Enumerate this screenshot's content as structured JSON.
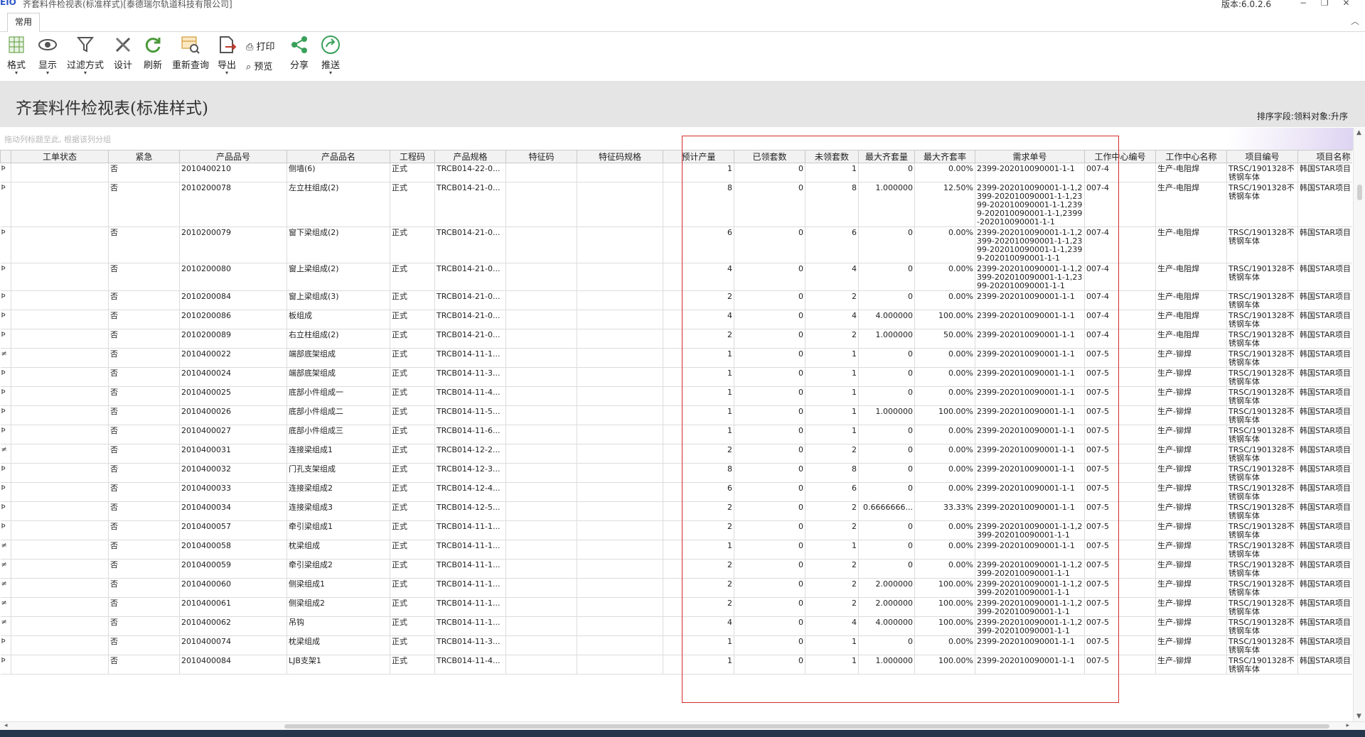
{
  "window": {
    "logo": "EIO",
    "title": "齐套料件检视表(标准样式)[泰德瑞尔轨道科技有限公司]",
    "version": "版本:6.0.2.6",
    "controls": "−  ❐  ✕"
  },
  "tabs": [
    {
      "label": "常用"
    }
  ],
  "collapse_glyph": "︿",
  "toolbar": {
    "format": "格式",
    "display": "显示",
    "filter": "过滤方式",
    "design": "设计",
    "refresh": "刷新",
    "requery": "重新查询",
    "export": "导出",
    "print": "打印",
    "preview": "预览",
    "share": "分享",
    "push": "推送",
    "dropdown_glyph": "▾"
  },
  "page": {
    "title": "齐套料件检视表(标准样式)",
    "sort_info": "排序字段:领料对象:升序"
  },
  "group_hint": "拖动列标题至此, 根据该列分组",
  "columns": [
    "工单状态",
    "紧急",
    "产品品号",
    "产品品名",
    "工程码",
    "产品规格",
    "特征码",
    "特征码规格",
    "预计产量",
    "已领套数",
    "未领套数",
    "最大齐套量",
    "最大齐套率",
    "需求单号",
    "工作中心编号",
    "工作中心名称",
    "项目编号",
    "项目名称"
  ],
  "rows": [
    {
      "ind": "Þ",
      "urgent": "否",
      "code": "2010400210",
      "name": "侧墙(6)",
      "eng": "正式",
      "spec": "TRCB014-22-0...",
      "feat": "",
      "featspec": "",
      "plan": "1",
      "taken": "0",
      "untaken": "1",
      "maxqty": "0",
      "maxrate": "0.00%",
      "req": "2399-202010090001-1-1",
      "wc": "007-4",
      "wcname": "生产-电阻焊",
      "proj": "TRSC/1901328不锈钢车体",
      "projname": "韩国STAR项目"
    },
    {
      "ind": "Þ",
      "urgent": "否",
      "code": "2010200078",
      "name": "左立柱组成(2)",
      "eng": "正式",
      "spec": "TRCB014-21-0...",
      "feat": "",
      "featspec": "",
      "plan": "8",
      "taken": "0",
      "untaken": "8",
      "maxqty": "1.000000",
      "maxrate": "12.50%",
      "req": "2399-202010090001-1-1,2399-202010090001-1-1,2399-202010090001-1-1,2399-202010090001-1-1,2399-202010090001-1-1",
      "wc": "007-4",
      "wcname": "生产-电阻焊",
      "proj": "TRSC/1901328不锈钢车体",
      "projname": "韩国STAR项目"
    },
    {
      "ind": "Þ",
      "urgent": "否",
      "code": "2010200079",
      "name": "窗下梁组成(2)",
      "eng": "正式",
      "spec": "TRCB014-21-0...",
      "feat": "",
      "featspec": "",
      "plan": "6",
      "taken": "0",
      "untaken": "6",
      "maxqty": "0",
      "maxrate": "0.00%",
      "req": "2399-202010090001-1-1,2399-202010090001-1-1,2399-202010090001-1-1,2399-202010090001-1-1",
      "wc": "007-4",
      "wcname": "生产-电阻焊",
      "proj": "TRSC/1901328不锈钢车体",
      "projname": "韩国STAR项目"
    },
    {
      "ind": "Þ",
      "urgent": "否",
      "code": "2010200080",
      "name": "窗上梁组成(2)",
      "eng": "正式",
      "spec": "TRCB014-21-0...",
      "feat": "",
      "featspec": "",
      "plan": "4",
      "taken": "0",
      "untaken": "4",
      "maxqty": "0",
      "maxrate": "0.00%",
      "req": "2399-202010090001-1-1,2399-202010090001-1-1,2399-202010090001-1-1",
      "wc": "007-4",
      "wcname": "生产-电阻焊",
      "proj": "TRSC/1901328不锈钢车体",
      "projname": "韩国STAR项目"
    },
    {
      "ind": "Þ",
      "urgent": "否",
      "code": "2010200084",
      "name": "窗上梁组成(3)",
      "eng": "正式",
      "spec": "TRCB014-21-0...",
      "feat": "",
      "featspec": "",
      "plan": "2",
      "taken": "0",
      "untaken": "2",
      "maxqty": "0",
      "maxrate": "0.00%",
      "req": "2399-202010090001-1-1",
      "wc": "007-4",
      "wcname": "生产-电阻焊",
      "proj": "TRSC/1901328不锈钢车体",
      "projname": "韩国STAR项目"
    },
    {
      "ind": "Þ",
      "urgent": "否",
      "code": "2010200086",
      "name": "板组成",
      "eng": "正式",
      "spec": "TRCB014-21-0...",
      "feat": "",
      "featspec": "",
      "plan": "4",
      "taken": "0",
      "untaken": "4",
      "maxqty": "4.000000",
      "maxrate": "100.00%",
      "req": "2399-202010090001-1-1",
      "wc": "007-4",
      "wcname": "生产-电阻焊",
      "proj": "TRSC/1901328不锈钢车体",
      "projname": "韩国STAR项目"
    },
    {
      "ind": "Þ",
      "urgent": "否",
      "code": "2010200089",
      "name": "右立柱组成(2)",
      "eng": "正式",
      "spec": "TRCB014-21-0...",
      "feat": "",
      "featspec": "",
      "plan": "2",
      "taken": "0",
      "untaken": "2",
      "maxqty": "1.000000",
      "maxrate": "50.00%",
      "req": "2399-202010090001-1-1",
      "wc": "007-4",
      "wcname": "生产-电阻焊",
      "proj": "TRSC/1901328不锈钢车体",
      "projname": "韩国STAR项目"
    },
    {
      "ind": "≠",
      "urgent": "否",
      "code": "2010400022",
      "name": "端部底架组成",
      "eng": "正式",
      "spec": "TRCB014-11-1...",
      "feat": "",
      "featspec": "",
      "plan": "1",
      "taken": "0",
      "untaken": "1",
      "maxqty": "0",
      "maxrate": "0.00%",
      "req": "2399-202010090001-1-1",
      "wc": "007-5",
      "wcname": "生产-铆焊",
      "proj": "TRSC/1901328不锈钢车体",
      "projname": "韩国STAR项目"
    },
    {
      "ind": "Þ",
      "urgent": "否",
      "code": "2010400024",
      "name": "端部底架组成",
      "eng": "正式",
      "spec": "TRCB014-11-3...",
      "feat": "",
      "featspec": "",
      "plan": "1",
      "taken": "0",
      "untaken": "1",
      "maxqty": "0",
      "maxrate": "0.00%",
      "req": "2399-202010090001-1-1",
      "wc": "007-5",
      "wcname": "生产-铆焊",
      "proj": "TRSC/1901328不锈钢车体",
      "projname": "韩国STAR项目"
    },
    {
      "ind": "Þ",
      "urgent": "否",
      "code": "2010400025",
      "name": "底部小件组成一",
      "eng": "正式",
      "spec": "TRCB014-11-4...",
      "feat": "",
      "featspec": "",
      "plan": "1",
      "taken": "0",
      "untaken": "1",
      "maxqty": "0",
      "maxrate": "0.00%",
      "req": "2399-202010090001-1-1",
      "wc": "007-5",
      "wcname": "生产-铆焊",
      "proj": "TRSC/1901328不锈钢车体",
      "projname": "韩国STAR项目"
    },
    {
      "ind": "Þ",
      "urgent": "否",
      "code": "2010400026",
      "name": "底部小件组成二",
      "eng": "正式",
      "spec": "TRCB014-11-5...",
      "feat": "",
      "featspec": "",
      "plan": "1",
      "taken": "0",
      "untaken": "1",
      "maxqty": "1.000000",
      "maxrate": "100.00%",
      "req": "2399-202010090001-1-1",
      "wc": "007-5",
      "wcname": "生产-铆焊",
      "proj": "TRSC/1901328不锈钢车体",
      "projname": "韩国STAR项目"
    },
    {
      "ind": "Þ",
      "urgent": "否",
      "code": "2010400027",
      "name": "底部小件组成三",
      "eng": "正式",
      "spec": "TRCB014-11-6...",
      "feat": "",
      "featspec": "",
      "plan": "1",
      "taken": "0",
      "untaken": "1",
      "maxqty": "0",
      "maxrate": "0.00%",
      "req": "2399-202010090001-1-1",
      "wc": "007-5",
      "wcname": "生产-铆焊",
      "proj": "TRSC/1901328不锈钢车体",
      "projname": "韩国STAR项目"
    },
    {
      "ind": "≠",
      "urgent": "否",
      "code": "2010400031",
      "name": "连接梁组成1",
      "eng": "正式",
      "spec": "TRCB014-12-2...",
      "feat": "",
      "featspec": "",
      "plan": "2",
      "taken": "0",
      "untaken": "2",
      "maxqty": "0",
      "maxrate": "0.00%",
      "req": "2399-202010090001-1-1",
      "wc": "007-5",
      "wcname": "生产-铆焊",
      "proj": "TRSC/1901328不锈钢车体",
      "projname": "韩国STAR项目"
    },
    {
      "ind": "Þ",
      "urgent": "否",
      "code": "2010400032",
      "name": "门孔支架组成",
      "eng": "正式",
      "spec": "TRCB014-12-3...",
      "feat": "",
      "featspec": "",
      "plan": "8",
      "taken": "0",
      "untaken": "8",
      "maxqty": "0",
      "maxrate": "0.00%",
      "req": "2399-202010090001-1-1",
      "wc": "007-5",
      "wcname": "生产-铆焊",
      "proj": "TRSC/1901328不锈钢车体",
      "projname": "韩国STAR项目"
    },
    {
      "ind": "Þ",
      "urgent": "否",
      "code": "2010400033",
      "name": "连接梁组成2",
      "eng": "正式",
      "spec": "TRCB014-12-4...",
      "feat": "",
      "featspec": "",
      "plan": "6",
      "taken": "0",
      "untaken": "6",
      "maxqty": "0",
      "maxrate": "0.00%",
      "req": "2399-202010090001-1-1",
      "wc": "007-5",
      "wcname": "生产-铆焊",
      "proj": "TRSC/1901328不锈钢车体",
      "projname": "韩国STAR项目"
    },
    {
      "ind": "Þ",
      "urgent": "否",
      "code": "2010400034",
      "name": "连接梁组成3",
      "eng": "正式",
      "spec": "TRCB014-12-5...",
      "feat": "",
      "featspec": "",
      "plan": "2",
      "taken": "0",
      "untaken": "2",
      "maxqty": "0.6666666...",
      "maxrate": "33.33%",
      "req": "2399-202010090001-1-1",
      "wc": "007-5",
      "wcname": "生产-铆焊",
      "proj": "TRSC/1901328不锈钢车体",
      "projname": "韩国STAR项目"
    },
    {
      "ind": "Þ",
      "urgent": "否",
      "code": "2010400057",
      "name": "牵引梁组成1",
      "eng": "正式",
      "spec": "TRCB014-11-1...",
      "feat": "",
      "featspec": "",
      "plan": "2",
      "taken": "0",
      "untaken": "2",
      "maxqty": "0",
      "maxrate": "0.00%",
      "req": "2399-202010090001-1-1,2399-202010090001-1-1",
      "wc": "007-5",
      "wcname": "生产-铆焊",
      "proj": "TRSC/1901328不锈钢车体",
      "projname": "韩国STAR项目"
    },
    {
      "ind": "≠",
      "urgent": "否",
      "code": "2010400058",
      "name": "枕梁组成",
      "eng": "正式",
      "spec": "TRCB014-11-1...",
      "feat": "",
      "featspec": "",
      "plan": "1",
      "taken": "0",
      "untaken": "1",
      "maxqty": "0",
      "maxrate": "0.00%",
      "req": "2399-202010090001-1-1",
      "wc": "007-5",
      "wcname": "生产-铆焊",
      "proj": "TRSC/1901328不锈钢车体",
      "projname": "韩国STAR项目"
    },
    {
      "ind": "≠",
      "urgent": "否",
      "code": "2010400059",
      "name": "牵引梁组成2",
      "eng": "正式",
      "spec": "TRCB014-11-1...",
      "feat": "",
      "featspec": "",
      "plan": "2",
      "taken": "0",
      "untaken": "2",
      "maxqty": "0",
      "maxrate": "0.00%",
      "req": "2399-202010090001-1-1,2399-202010090001-1-1",
      "wc": "007-5",
      "wcname": "生产-铆焊",
      "proj": "TRSC/1901328不锈钢车体",
      "projname": "韩国STAR项目"
    },
    {
      "ind": "≠",
      "urgent": "否",
      "code": "2010400060",
      "name": "侧梁组成1",
      "eng": "正式",
      "spec": "TRCB014-11-1...",
      "feat": "",
      "featspec": "",
      "plan": "2",
      "taken": "0",
      "untaken": "2",
      "maxqty": "2.000000",
      "maxrate": "100.00%",
      "req": "2399-202010090001-1-1,2399-202010090001-1-1",
      "wc": "007-5",
      "wcname": "生产-铆焊",
      "proj": "TRSC/1901328不锈钢车体",
      "projname": "韩国STAR项目"
    },
    {
      "ind": "≠",
      "urgent": "否",
      "code": "2010400061",
      "name": "侧梁组成2",
      "eng": "正式",
      "spec": "TRCB014-11-1...",
      "feat": "",
      "featspec": "",
      "plan": "2",
      "taken": "0",
      "untaken": "2",
      "maxqty": "2.000000",
      "maxrate": "100.00%",
      "req": "2399-202010090001-1-1,2399-202010090001-1-1",
      "wc": "007-5",
      "wcname": "生产-铆焊",
      "proj": "TRSC/1901328不锈钢车体",
      "projname": "韩国STAR项目"
    },
    {
      "ind": "≠",
      "urgent": "否",
      "code": "2010400062",
      "name": "吊钩",
      "eng": "正式",
      "spec": "TRCB014-11-1...",
      "feat": "",
      "featspec": "",
      "plan": "4",
      "taken": "0",
      "untaken": "4",
      "maxqty": "4.000000",
      "maxrate": "100.00%",
      "req": "2399-202010090001-1-1,2399-202010090001-1-1",
      "wc": "007-5",
      "wcname": "生产-铆焊",
      "proj": "TRSC/1901328不锈钢车体",
      "projname": "韩国STAR项目"
    },
    {
      "ind": "Þ",
      "urgent": "否",
      "code": "2010400074",
      "name": "枕梁组成",
      "eng": "正式",
      "spec": "TRCB014-11-3...",
      "feat": "",
      "featspec": "",
      "plan": "1",
      "taken": "0",
      "untaken": "1",
      "maxqty": "0",
      "maxrate": "0.00%",
      "req": "2399-202010090001-1-1",
      "wc": "007-5",
      "wcname": "生产-铆焊",
      "proj": "TRSC/1901328不锈钢车体",
      "projname": "韩国STAR项目"
    },
    {
      "ind": "Þ",
      "urgent": "否",
      "code": "2010400084",
      "name": "LJB支架1",
      "eng": "正式",
      "spec": "TRCB014-11-4...",
      "feat": "",
      "featspec": "",
      "plan": "1",
      "taken": "0",
      "untaken": "1",
      "maxqty": "1.000000",
      "maxrate": "100.00%",
      "req": "2399-202010090001-1-1",
      "wc": "007-5",
      "wcname": "生产-铆焊",
      "proj": "TRSC/1901328不锈钢车体",
      "projname": "韩国STAR项目"
    }
  ],
  "colors": {
    "highlight": "#d62b2b",
    "header_band": "#e5e5e5",
    "statusbar": "#26374c"
  }
}
